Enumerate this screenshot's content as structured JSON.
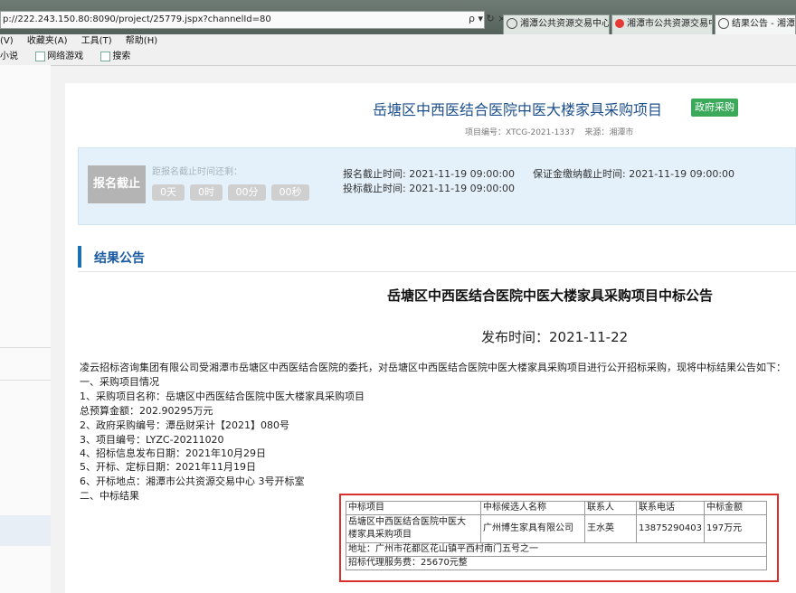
{
  "browser": {
    "url": "p://222.243.150.80:8090/project/25779.jspx?channelId=80",
    "url_tools": "ρ ▾ ↻ ×",
    "tabs": [
      {
        "label": "湘潭公共资源交易中心企…"
      },
      {
        "label": "湘潭市公共资源交易中心"
      },
      {
        "label": "结果公告 - 湘潭市公…"
      }
    ],
    "menu": [
      "(V)",
      "收藏夹(A)",
      "工具(T)",
      "帮助(H)"
    ],
    "favorites": [
      "小说",
      "网络游戏",
      "搜索"
    ]
  },
  "project": {
    "title": "岳塘区中西医结合医院中医大楼家具采购项目",
    "badge": "政府采购",
    "code": "项目编号：XTCG-2021-1337",
    "source": "来源：湘潭市"
  },
  "status": {
    "closed_label": "报名截止",
    "countdown_label": "距报名截止时间还剩：",
    "countdown": [
      "0天",
      "0时",
      "00分",
      "00秒"
    ],
    "register_deadline": "报名截止时间: 2021-11-19 09:00:00",
    "bid_deadline": "投标截止时间: 2021-11-19 09:00:00",
    "deposit_deadline": "保证金缴纳截止时间: 2021-11-19 09:00:00"
  },
  "section": {
    "title": "结果公告"
  },
  "notice": {
    "title": "岳塘区中西医结合医院中医大楼家具采购项目中标公告",
    "publish": "发布时间：2021-11-22",
    "lines": [
      "凌云招标咨询集团有限公司受湘潭市岳塘区中西医结合医院的委托，对岳塘区中西医结合医院中医大楼家具采购项目进行公开招标采购，现将中标结果公告如下：",
      "一、采购项目情况",
      "1、采购项目名称：岳塘区中西医结合医院中医大楼家具采购项目",
      "总预算金额：202.90295万元",
      "2、政府采购编号：潭岳财采计【2021】080号",
      "3、项目编号：LYZC-20211020",
      "4、招标信息发布日期：2021年10月29日",
      "5、开标、定标日期：2021年11月19日",
      "6、开标地点：湘潭市公共资源交易中心 3号开标室",
      "二、中标结果"
    ]
  },
  "result_table": {
    "headers": [
      "中标项目",
      "中标候选人名称",
      "联系人",
      "联系电话",
      "中标金额"
    ],
    "row": {
      "project_line1": "岳塘区中西医结合医院中医大",
      "project_line2": "楼家具采购项目",
      "candidate": "广州博生家具有限公司",
      "contact": "王水英",
      "phone": "13875290403",
      "amount": "197万元"
    },
    "address": "地址：广州市花都区花山镇平西村南门五号之一",
    "agency_fee": "招标代理服务费：25670元整"
  }
}
